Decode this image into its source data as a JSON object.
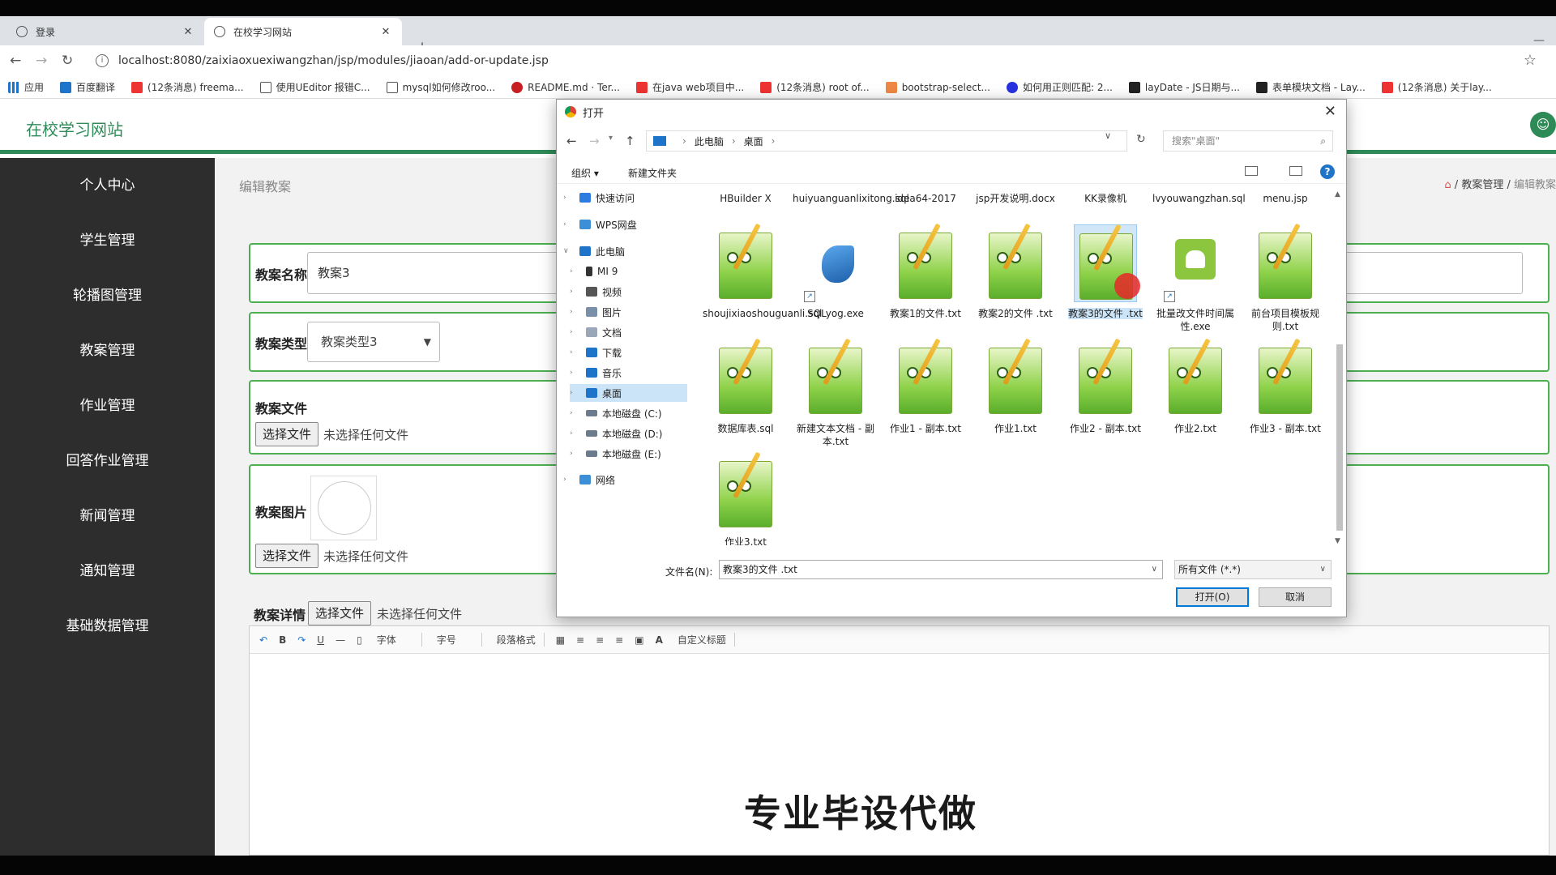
{
  "browser": {
    "tabs": [
      {
        "title": "登录",
        "active": false
      },
      {
        "title": "在校学习网站",
        "active": true
      }
    ],
    "url": "localhost:8080/zaixiaoxuexiwangzhan/jsp/modules/jiaoan/add-or-update.jsp",
    "bookmarks": [
      "应用",
      "百度翻译",
      "(12条消息) freema...",
      "使用UEditor 报错C...",
      "mysql如何修改roo...",
      "README.md · Ter...",
      "在java web项目中...",
      "(12条消息) root of...",
      "bootstrap-select...",
      "如何用正则匹配: 2...",
      "layDate - JS日期与...",
      "表单模块文档 - Lay...",
      "(12条消息) 关于lay..."
    ]
  },
  "site": {
    "title": "在校学习网站",
    "sidebar": [
      "个人中心",
      "学生管理",
      "轮播图管理",
      "教案管理",
      "作业管理",
      "回答作业管理",
      "新闻管理",
      "通知管理",
      "基础数据管理"
    ],
    "page_subtitle": "编辑教案",
    "breadcrumb": [
      "教案管理",
      "编辑教案"
    ]
  },
  "form": {
    "name_label": "教案名称",
    "name_value": "教案3",
    "type_label": "教案类型",
    "type_value": "教案类型3",
    "file_label": "教案文件",
    "image_label": "教案图片",
    "detail_label": "教案详情",
    "choose_file": "选择文件",
    "no_file": "未选择任何文件"
  },
  "editor": {
    "toolbar": [
      "B",
      "U",
      "—",
      "字体",
      "字号",
      "段落格式",
      "A",
      "自定义标题"
    ],
    "watermark": "专业毕设代做"
  },
  "dialog": {
    "title": "打开",
    "path": [
      "此电脑",
      "桌面"
    ],
    "search_placeholder": "搜索\"桌面\"",
    "organize": "组织 ▾",
    "new_folder": "新建文件夹",
    "tree": [
      {
        "label": "快速访问",
        "level": 0,
        "icon_color": "#2d7de0"
      },
      {
        "label": "WPS网盘",
        "level": 0,
        "icon_color": "#3a8fd6"
      },
      {
        "label": "此电脑",
        "level": 0,
        "icon_color": "#1e74c8",
        "expanded": true
      },
      {
        "label": "MI 9",
        "level": 1,
        "icon_color": "#333"
      },
      {
        "label": "视频",
        "level": 1,
        "icon_color": "#555"
      },
      {
        "label": "图片",
        "level": 1,
        "icon_color": "#7a8fa8"
      },
      {
        "label": "文档",
        "level": 1,
        "icon_color": "#9aa7b8"
      },
      {
        "label": "下载",
        "level": 1,
        "icon_color": "#1e74c8"
      },
      {
        "label": "音乐",
        "level": 1,
        "icon_color": "#1e74c8"
      },
      {
        "label": "桌面",
        "level": 1,
        "icon_color": "#1e74c8",
        "selected": true
      },
      {
        "label": "本地磁盘 (C:)",
        "level": 1,
        "icon_color": "#6a7b8c"
      },
      {
        "label": "本地磁盘 (D:)",
        "level": 1,
        "icon_color": "#6a7b8c"
      },
      {
        "label": "本地磁盘 (E:)",
        "level": 1,
        "icon_color": "#6a7b8c"
      },
      {
        "label": "网络",
        "level": 0,
        "icon_color": "#3a8fd6"
      }
    ],
    "files_top_row": [
      "HBuilder X",
      "huiyuanguanlixitong.sql",
      "idea64-2017",
      "jsp开发说明.docx",
      "KK录像机",
      "lvyouwangzhan.sql",
      "menu.jsp"
    ],
    "files": [
      {
        "name": "shoujixiaoshouguanli.sql",
        "icon": "notepad"
      },
      {
        "name": "SQLyog.exe",
        "icon": "sqlyog",
        "shortcut": true
      },
      {
        "name": "教案1的文件.txt",
        "icon": "notepad"
      },
      {
        "name": "教案2的文件 .txt",
        "icon": "notepad"
      },
      {
        "name": "教案3的文件 .txt",
        "icon": "notepad",
        "selected": true
      },
      {
        "name": "批量改文件时间属性.exe",
        "icon": "apk",
        "shortcut": true
      },
      {
        "name": "前台项目模板规则.txt",
        "icon": "notepad"
      },
      {
        "name": "数据库表.sql",
        "icon": "notepad"
      },
      {
        "name": "新建文本文档 - 副本.txt",
        "icon": "notepad"
      },
      {
        "name": "作业1 - 副本.txt",
        "icon": "notepad"
      },
      {
        "name": "作业1.txt",
        "icon": "notepad"
      },
      {
        "name": "作业2 - 副本.txt",
        "icon": "notepad"
      },
      {
        "name": "作业2.txt",
        "icon": "notepad"
      },
      {
        "name": "作业3 - 副本.txt",
        "icon": "notepad"
      },
      {
        "name": "作业3.txt",
        "icon": "notepad"
      }
    ],
    "filename_label": "文件名(N):",
    "filename_value": "教案3的文件 .txt",
    "filter_value": "所有文件 (*.*)",
    "open_button": "打开(O)",
    "cancel_button": "取消"
  }
}
